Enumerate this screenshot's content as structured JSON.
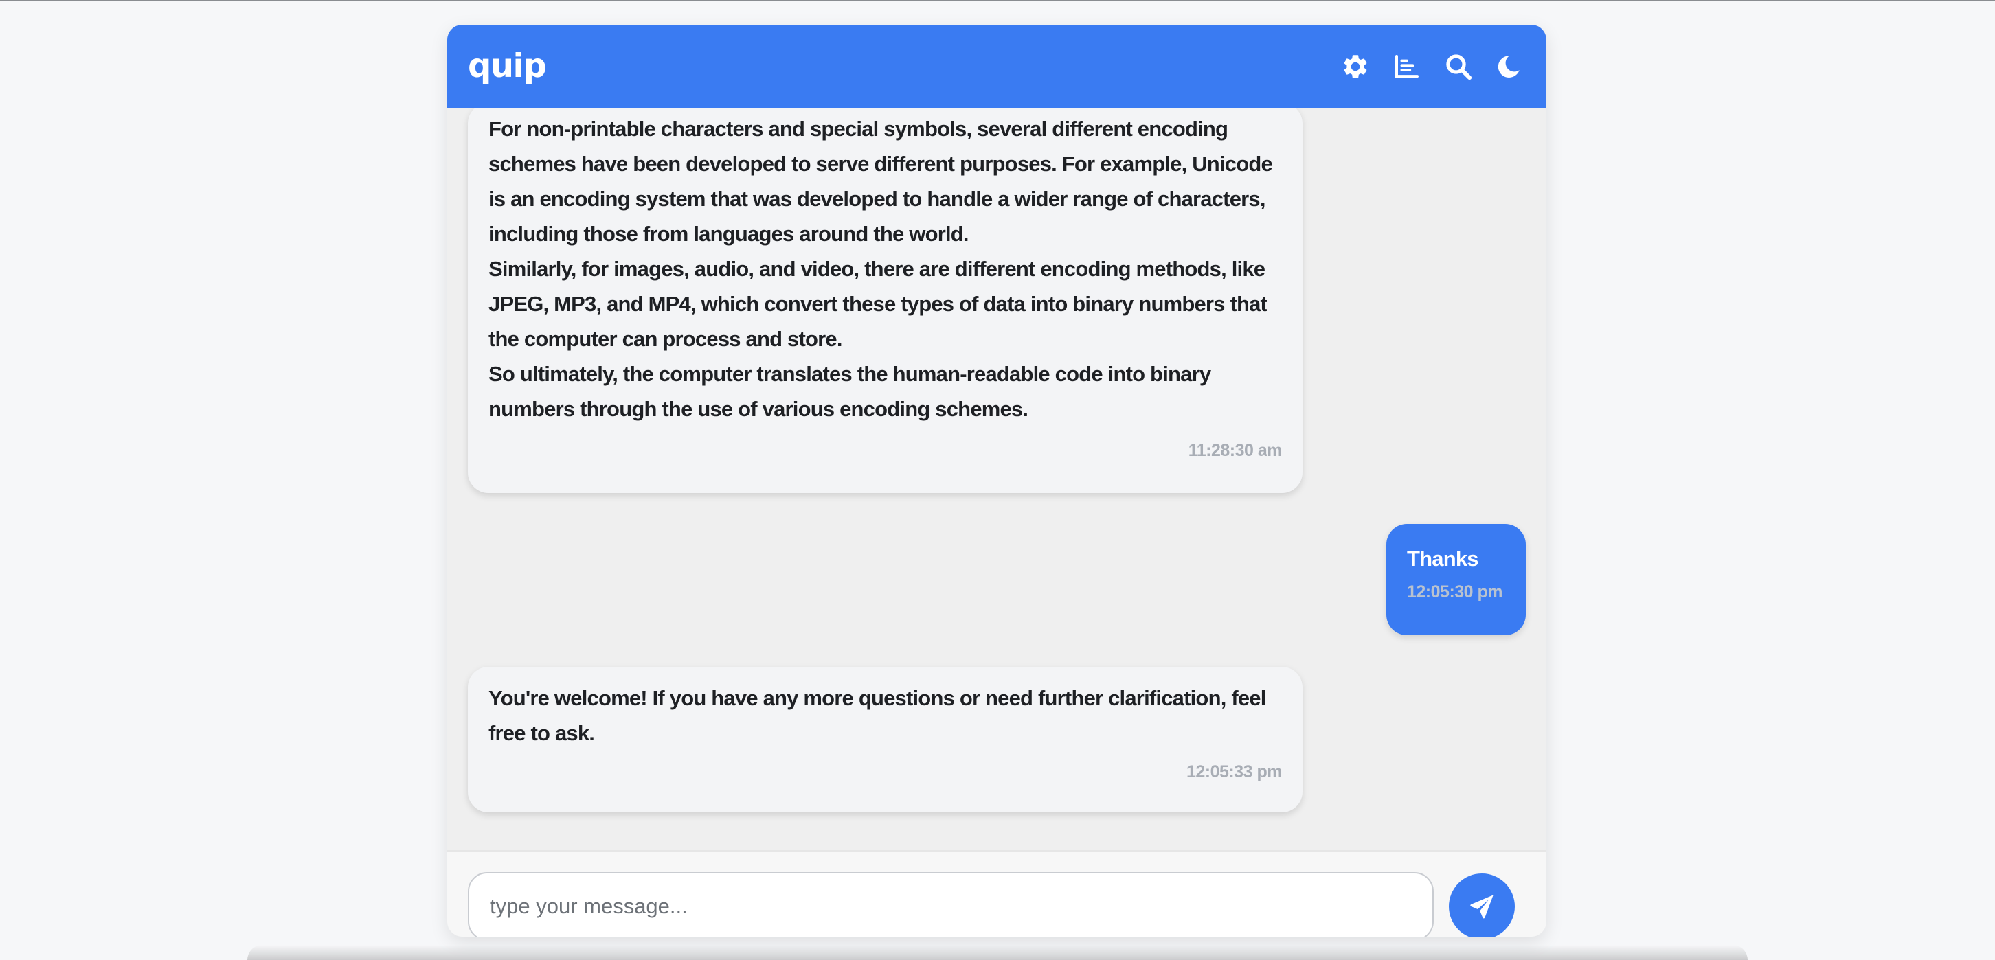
{
  "app": {
    "title": "quip",
    "accent_color": "#3a7bf2"
  },
  "header": {
    "icons": [
      "gear-icon",
      "chart-icon",
      "search-icon",
      "moon-icon"
    ]
  },
  "messages": [
    {
      "sender": "bot",
      "lines": [
        "For non-printable characters and special symbols, several different encoding",
        "schemes have been developed to serve different purposes. For example, Unicode",
        "is an encoding system that was developed to handle a wider range of characters,",
        "including those from languages around the world.",
        "Similarly, for images, audio, and video, there are different encoding methods, like",
        "JPEG, MP3, and MP4, which convert these types of data into binary numbers that",
        "the computer can process and store.",
        "So ultimately, the computer translates the human-readable code into binary",
        "numbers through the use of various encoding schemes."
      ],
      "time": "11:28:30 am"
    },
    {
      "sender": "user",
      "lines": [
        "Thanks"
      ],
      "time": "12:05:30 pm"
    },
    {
      "sender": "bot",
      "lines": [
        "You're welcome! If you have any more questions or need further clarification, feel",
        "free to ask."
      ],
      "time": "12:05:33 pm"
    }
  ],
  "composer": {
    "placeholder": "type your message...",
    "value": "",
    "send_icon": "paper-plane-icon"
  }
}
